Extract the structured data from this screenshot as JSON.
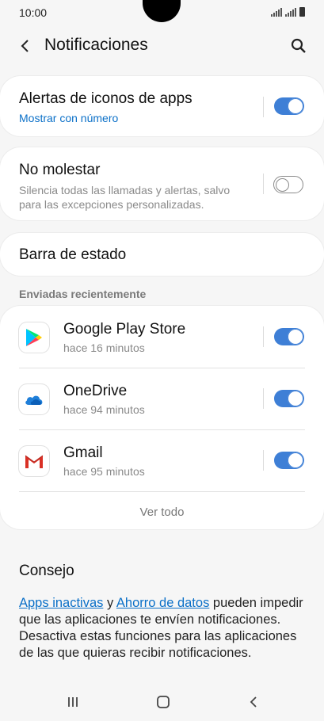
{
  "status_bar": {
    "time": "10:00"
  },
  "header": {
    "title": "Notificaciones"
  },
  "badges": {
    "title": "Alertas de iconos de apps",
    "subtitle": "Mostrar con número",
    "enabled": true
  },
  "dnd": {
    "title": "No molestar",
    "subtitle_line1": "Silencia todas las llamadas y alertas, salvo",
    "subtitle_line2": "para las excepciones personalizadas.",
    "enabled": false
  },
  "status_bar_setting": {
    "title": "Barra de estado"
  },
  "recent": {
    "label": "Enviadas recientemente",
    "apps": [
      {
        "name": "Google Play Store",
        "time": "hace 16 minutos",
        "icon": "google-play-icon",
        "enabled": true
      },
      {
        "name": "OneDrive",
        "time": "hace 94 minutos",
        "icon": "onedrive-icon",
        "enabled": true
      },
      {
        "name": "Gmail",
        "time": "hace 95 minutos",
        "icon": "gmail-icon",
        "enabled": true
      }
    ],
    "view_all": "Ver todo"
  },
  "tip": {
    "title": "Consejo",
    "link1": "Apps inactivas",
    "connector": " y ",
    "link2": "Ahorro de datos",
    "text": " pueden impedir que las aplicaciones te envíen notificaciones. Desactiva estas funciones para las aplicaciones de las que quieras recibir notificaciones."
  },
  "colors": {
    "accent": "#3e7fd6",
    "link": "#0b70c8",
    "background": "#f6f6f6"
  }
}
